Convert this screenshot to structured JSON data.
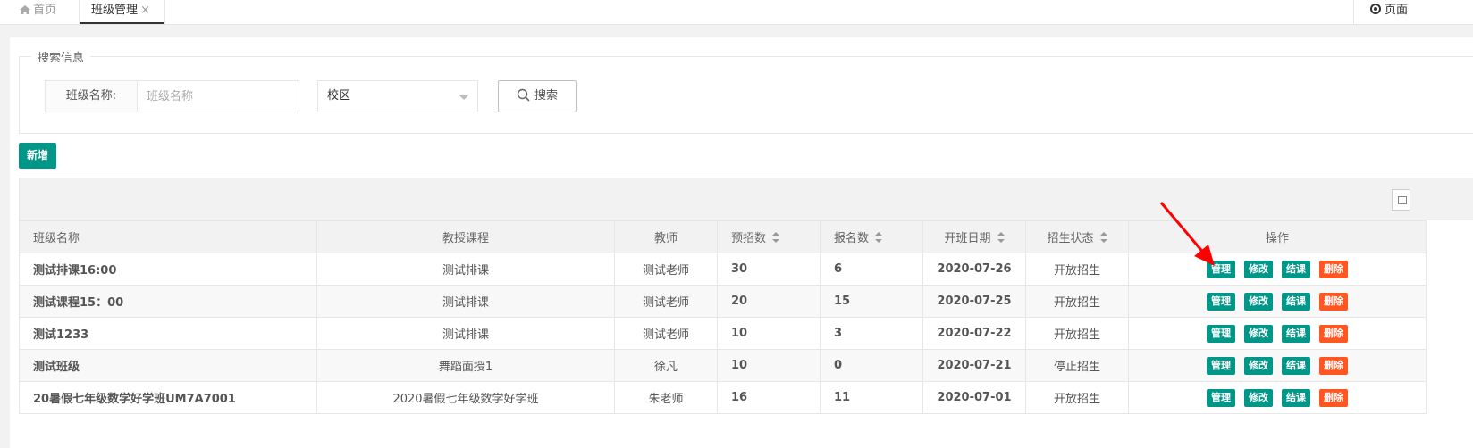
{
  "tabs": {
    "home": "首页",
    "current": "班级管理",
    "close": "×",
    "page_ops": "页面"
  },
  "search": {
    "legend": "搜索信息",
    "name_label": "班级名称:",
    "name_placeholder": "班级名称",
    "campus_value": "校区",
    "search_button": "搜索"
  },
  "actions": {
    "add": "新增"
  },
  "table": {
    "headers": [
      "班级名称",
      "教授课程",
      "教师",
      "预招数",
      "报名数",
      "开班日期",
      "招生状态",
      "操作"
    ],
    "op_labels": {
      "manage": "管理",
      "edit": "修改",
      "finish": "结课",
      "delete": "删除"
    },
    "rows": [
      {
        "name": "测试排课16:00",
        "course": "测试排课",
        "teacher": "测试老师",
        "planned": "30",
        "enrolled": "6",
        "start_date": "2020-07-26",
        "status": "开放招生"
      },
      {
        "name": "测试课程15：00",
        "course": "测试排课",
        "teacher": "测试老师",
        "planned": "20",
        "enrolled": "15",
        "start_date": "2020-07-25",
        "status": "开放招生"
      },
      {
        "name": "测试1233",
        "course": "测试排课",
        "teacher": "测试老师",
        "planned": "10",
        "enrolled": "3",
        "start_date": "2020-07-22",
        "status": "开放招生"
      },
      {
        "name": "测试班级",
        "course": "舞蹈面授1",
        "teacher": "徐凡",
        "planned": "10",
        "enrolled": "0",
        "start_date": "2020-07-21",
        "status": "停止招生"
      },
      {
        "name": "20暑假七年级数学好学班UM7A7001",
        "course": "2020暑假七年级数学好学班",
        "teacher": "朱老师",
        "planned": "16",
        "enrolled": "11",
        "start_date": "2020-07-01",
        "status": "开放招生"
      }
    ]
  },
  "colors": {
    "primary": "#009688",
    "danger": "#ff5722",
    "annotation": "#ff0000"
  }
}
